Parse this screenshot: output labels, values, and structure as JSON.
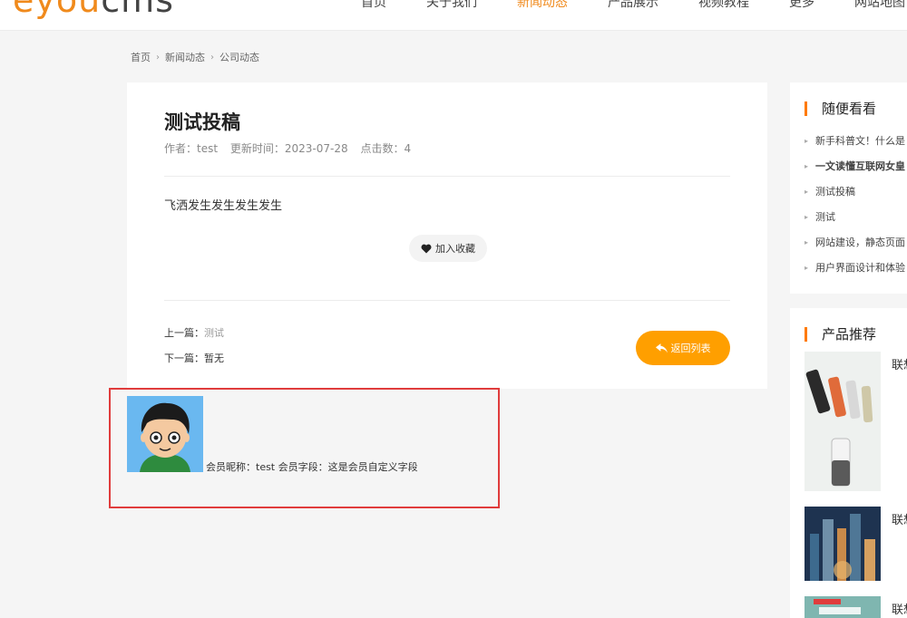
{
  "header": {
    "logo_orange": "eyou",
    "logo_dark": "cms",
    "nav": [
      "首页",
      "关于我们",
      "新闻动态",
      "产品展示",
      "视频教程",
      "更多",
      "网站地图"
    ]
  },
  "breadcrumb": [
    "首页",
    "新闻动态",
    "公司动态"
  ],
  "article": {
    "title": "测试投稿",
    "author": "作者：test",
    "updated": "更新时间：2023-07-28",
    "clicks": "点击数：4",
    "content": "飞洒发生发生发生发生",
    "fav_label": "加入收藏",
    "prev_label": "上一篇：",
    "prev_link": "测试",
    "next_label": "下一篇：",
    "next_link": "暂无",
    "back_label": "返回列表"
  },
  "member": {
    "info": "会员昵称：test 会员字段：这是会员自定义字段"
  },
  "sidebar": {
    "random_title": "随便看看",
    "random_items": [
      "新手科普文！什么是",
      "一文读懂互联网女皇",
      "测试投稿",
      "测试",
      "网站建设，静态页面",
      "用户界面设计和体验"
    ],
    "product_title": "产品推荐",
    "products": [
      "联想",
      "联想",
      "联想"
    ]
  },
  "colors": {
    "accent": "#ff9f00",
    "brand": "#f08a1c",
    "highlight_border": "#e03c3c"
  }
}
